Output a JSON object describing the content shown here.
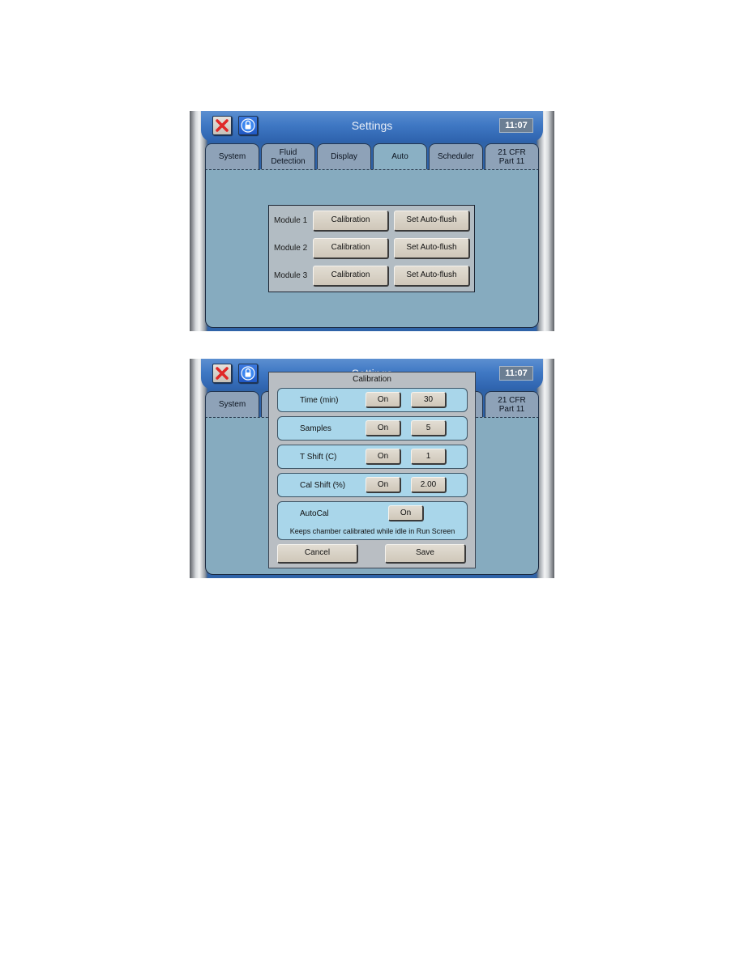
{
  "screens": [
    {
      "header": {
        "title": "Settings",
        "clock": "11:07"
      },
      "toolbar": {
        "close_icon": "close-icon",
        "lock_icon": "lock-icon"
      },
      "tabs": [
        {
          "label_line1": "System",
          "label_line2": ""
        },
        {
          "label_line1": "Fluid",
          "label_line2": "Detection"
        },
        {
          "label_line1": "Display",
          "label_line2": ""
        },
        {
          "label_line1": "Auto",
          "label_line2": "",
          "active": true
        },
        {
          "label_line1": "Scheduler",
          "label_line2": ""
        },
        {
          "label_line1": "21 CFR",
          "label_line2": "Part 11"
        }
      ],
      "modules": [
        {
          "label": "Module 1",
          "calibration": "Calibration",
          "autoflush": "Set Auto-flush"
        },
        {
          "label": "Module 2",
          "calibration": "Calibration",
          "autoflush": "Set Auto-flush"
        },
        {
          "label": "Module 3",
          "calibration": "Calibration",
          "autoflush": "Set Auto-flush"
        }
      ]
    },
    {
      "header": {
        "title": "Settings",
        "clock": "11:07"
      },
      "tabs_visible": [
        {
          "label_line1": "System",
          "label_line2": ""
        },
        {
          "label_line1": "21 CFR",
          "label_line2": "Part 11"
        }
      ],
      "dialog": {
        "title": "Calibration",
        "rows": [
          {
            "label": "Time (min)",
            "toggle": "On",
            "value": "30"
          },
          {
            "label": "Samples",
            "toggle": "On",
            "value": "5"
          },
          {
            "label": "T Shift (C)",
            "toggle": "On",
            "value": "1"
          },
          {
            "label": "Cal Shift (%)",
            "toggle": "On",
            "value": "2.00"
          }
        ],
        "autocal": {
          "label": "AutoCal",
          "toggle": "On",
          "description": "Keeps chamber calibrated while idle in Run Screen"
        },
        "cancel_label": "Cancel",
        "save_label": "Save"
      }
    }
  ]
}
